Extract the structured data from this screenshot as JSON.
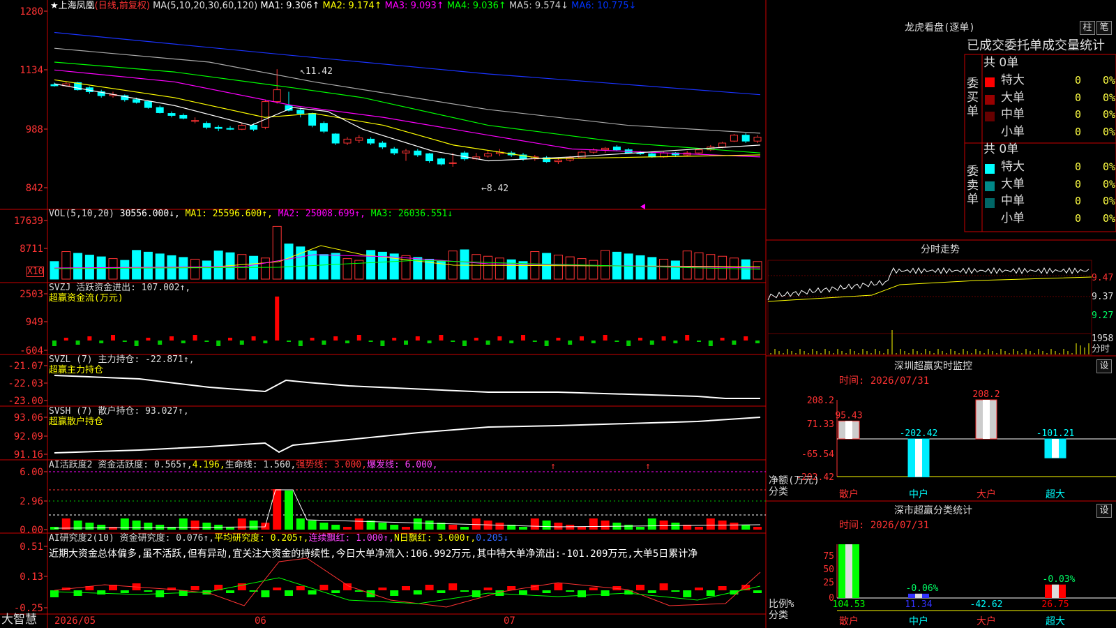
{
  "main": {
    "title": "★上海凤凰",
    "title_suffix": "(日线,前复权)",
    "ma_params": "MA(5,10,20,30,60,120)",
    "ma_values": [
      {
        "label": "MA1: 9.306↑",
        "color": "#ffffff"
      },
      {
        "label": "MA2: 9.174↑",
        "color": "#ffff00"
      },
      {
        "label": "MA3: 9.093↑",
        "color": "#ff00ff"
      },
      {
        "label": "MA4: 9.036↑",
        "color": "#00ff00"
      },
      {
        "label": "MA5: 9.574↓",
        "color": "#cccccc"
      },
      {
        "label": "MA6: 10.775↓",
        "color": "#0033ff"
      }
    ],
    "yticks": [
      "1280",
      "1134",
      "988",
      "842"
    ],
    "high_label": "11.42",
    "low_label": "8.42"
  },
  "vol": {
    "header": "VOL(5,10,20)",
    "values": [
      {
        "label": "30556.000↓,",
        "color": "#ffffff"
      },
      {
        "label": "MA1: 25596.600↑,",
        "color": "#ffff00"
      },
      {
        "label": "MA2: 25008.699↑,",
        "color": "#ff00ff"
      },
      {
        "label": "MA3: 26036.551↓",
        "color": "#00ff00"
      }
    ],
    "yticks": [
      "17639",
      "8711"
    ],
    "unit": "X10"
  },
  "svzj": {
    "header": "SVZJ  活跃资金进出: 107.002↑,",
    "subtitle": "超赢资金流(万元)",
    "yticks": [
      "2503",
      "949",
      "-604"
    ]
  },
  "svzl": {
    "header": "SVZL (7) 主力持仓: -22.871↑,",
    "subtitle": "超赢主力持仓",
    "yticks": [
      "-21.07",
      "-22.03",
      "-23.00"
    ]
  },
  "svsh": {
    "header": "SVSH (7) 散户持仓: 93.027↑,",
    "subtitle": "超赢散户持仓",
    "yticks": [
      "93.06",
      "92.09",
      "91.16"
    ]
  },
  "ai1": {
    "h1": "AI活跃度2 资金活跃度: 0.565↑,",
    "h2": "4.196,",
    "h3": "生命线: 1.560,",
    "h4": "强势线: 3.000,",
    "h5": "爆发线: 6.000,",
    "yticks": [
      "6.00",
      "2.96",
      "0.00"
    ]
  },
  "ai2": {
    "h1": "AI研究度2(10) 资金研究度: 0.076↑,",
    "h2": "平均研究度: 0.205↑,",
    "h3": "连续飘红: 1.000↑,",
    "h4": "N日飘红: 3.000↑,",
    "h5": "0.205↓",
    "comment": "近期大资金总体偏多,虽不活跃,但有异动,宜关注大资金的持续性,今日大单净流入:106.992万元,其中特大单净流出:-101.209万元,大单5日累计净",
    "yticks": [
      "0.51",
      "0.13",
      "-0.25"
    ]
  },
  "xaxis": {
    "brand": "大智慧",
    "labels": [
      "2026/05",
      "06",
      "07"
    ]
  },
  "lhb": {
    "title": "龙虎看盘(逐单)",
    "btn_zhu": "柱",
    "btn_bi": "笔",
    "sub": "已成交委托单成交量统计",
    "buy_side": "委买单",
    "sell_side": "委卖单",
    "buy_total": "共 0单",
    "sell_total": "共 0单",
    "buy_rows": [
      {
        "label": "特大",
        "count": "0",
        "pct": "0%",
        "color": "#ff0000"
      },
      {
        "label": "大单",
        "count": "0",
        "pct": "0%",
        "color": "#990000"
      },
      {
        "label": "中单",
        "count": "0",
        "pct": "0%",
        "color": "#660000"
      },
      {
        "label": "小单",
        "count": "0",
        "pct": "0%",
        "color": "#000000"
      }
    ],
    "sell_rows": [
      {
        "label": "特大",
        "count": "0",
        "pct": "0%",
        "color": "#00ffff"
      },
      {
        "label": "大单",
        "count": "0",
        "pct": "0%",
        "color": "#008888"
      },
      {
        "label": "中单",
        "count": "0",
        "pct": "0%",
        "color": "#006666"
      },
      {
        "label": "小单",
        "count": "0",
        "pct": "0%",
        "color": "#000000"
      }
    ]
  },
  "fenshi": {
    "title": "分时走势",
    "yticks": [
      "9.47",
      "9.37",
      "9.27"
    ],
    "vol_label": "1958",
    "vol_unit": "分时"
  },
  "monitor": {
    "title": "深圳超赢实时监控",
    "btn": "设",
    "time": "时间: 2026/07/31",
    "yticks": [
      "208.2",
      "71.33",
      "-65.54",
      "-202.42"
    ],
    "ylabel1": "净额(万元)",
    "ylabel2": "分类",
    "bars": [
      {
        "cat": "散户",
        "value": 95.43,
        "label": "95.43"
      },
      {
        "cat": "中户",
        "value": -202.42,
        "label": "-202.42"
      },
      {
        "cat": "大户",
        "value": 208.2,
        "label": "208.2"
      },
      {
        "cat": "超大",
        "value": -101.21,
        "label": "-101.21"
      }
    ]
  },
  "classify": {
    "title": "深市超赢分类统计",
    "btn": "设",
    "time": "时间: 2026/07/31",
    "yticks": [
      "75",
      "50",
      "25",
      "0"
    ],
    "ylabel1": "比例%",
    "ylabel2": "分类",
    "bars": [
      {
        "cat": "散户",
        "pct": 100,
        "tag": "",
        "value": "104.53",
        "color": "#00ff00"
      },
      {
        "cat": "中户",
        "pct": 8,
        "tag": "-0.06%",
        "value": "11.34",
        "color": "#3333ff"
      },
      {
        "cat": "大户",
        "pct": 0,
        "tag": "",
        "value": "-42.62",
        "color": "#ffffff"
      },
      {
        "cat": "超大",
        "pct": 25,
        "tag": "-0.03%",
        "value": "26.75",
        "color": "#ff0000"
      }
    ]
  }
}
